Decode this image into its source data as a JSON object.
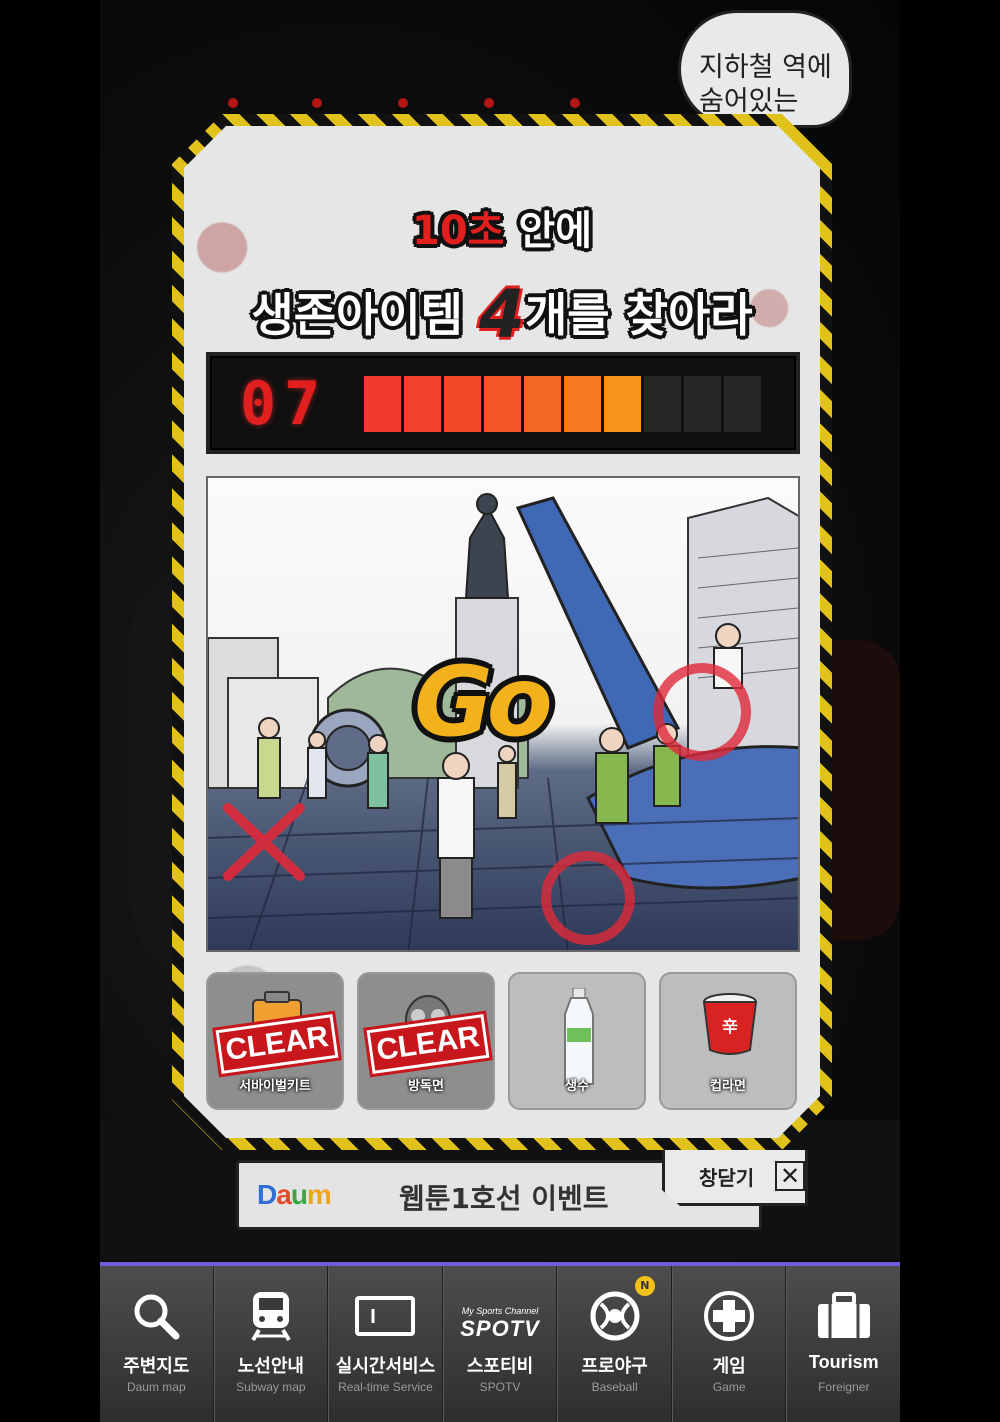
{
  "background": {
    "speech_bubble": "지하철 역에\n숨어있는"
  },
  "modal": {
    "title_line1_red": "10초",
    "title_line1_rest": " 안에",
    "title_line2_a": "생존아이템 ",
    "title_line2_num": "4",
    "title_line2_b": "개를 찾아라",
    "timer_value": "07",
    "timer_total_segments": 10,
    "timer_filled_segments": 7,
    "timer_colors": [
      "#f23a2e",
      "#f2402c",
      "#f3472a",
      "#f45527",
      "#f56824",
      "#f77a20",
      "#f8941c"
    ],
    "go_label": "Go",
    "items": [
      {
        "label": "서바이벌키트",
        "cleared": true,
        "icon": "survival-kit-icon"
      },
      {
        "label": "방독면",
        "cleared": true,
        "icon": "gas-mask-icon"
      },
      {
        "label": "생수",
        "cleared": false,
        "icon": "water-bottle-icon"
      },
      {
        "label": "컵라면",
        "cleared": false,
        "icon": "cup-noodle-icon"
      }
    ],
    "clear_stamp": "CLEAR",
    "close_label": "창닫기",
    "close_icon": "close-icon"
  },
  "event_banner": {
    "logo": "Daum",
    "text": "웹툰1호선 이벤트"
  },
  "nav": [
    {
      "label": "주변지도",
      "sub": "Daum map",
      "icon": "search-icon"
    },
    {
      "label": "노선안내",
      "sub": "Subway map",
      "icon": "train-icon"
    },
    {
      "label": "실시간서비스",
      "sub": "Real-time Service",
      "icon": "display-icon"
    },
    {
      "label": "스포티비",
      "sub": "SPOTV",
      "icon": "spotv-logo-icon",
      "logo_top": "My Sports Channel",
      "logo_main": "SPOTV"
    },
    {
      "label": "프로야구",
      "sub": "Baseball",
      "icon": "baseball-logo-icon",
      "badge": "N"
    },
    {
      "label": "게임",
      "sub": "Game",
      "icon": "game-pad-icon"
    },
    {
      "label": "Tourism",
      "sub": "Foreigner",
      "icon": "suitcase-icon"
    }
  ]
}
